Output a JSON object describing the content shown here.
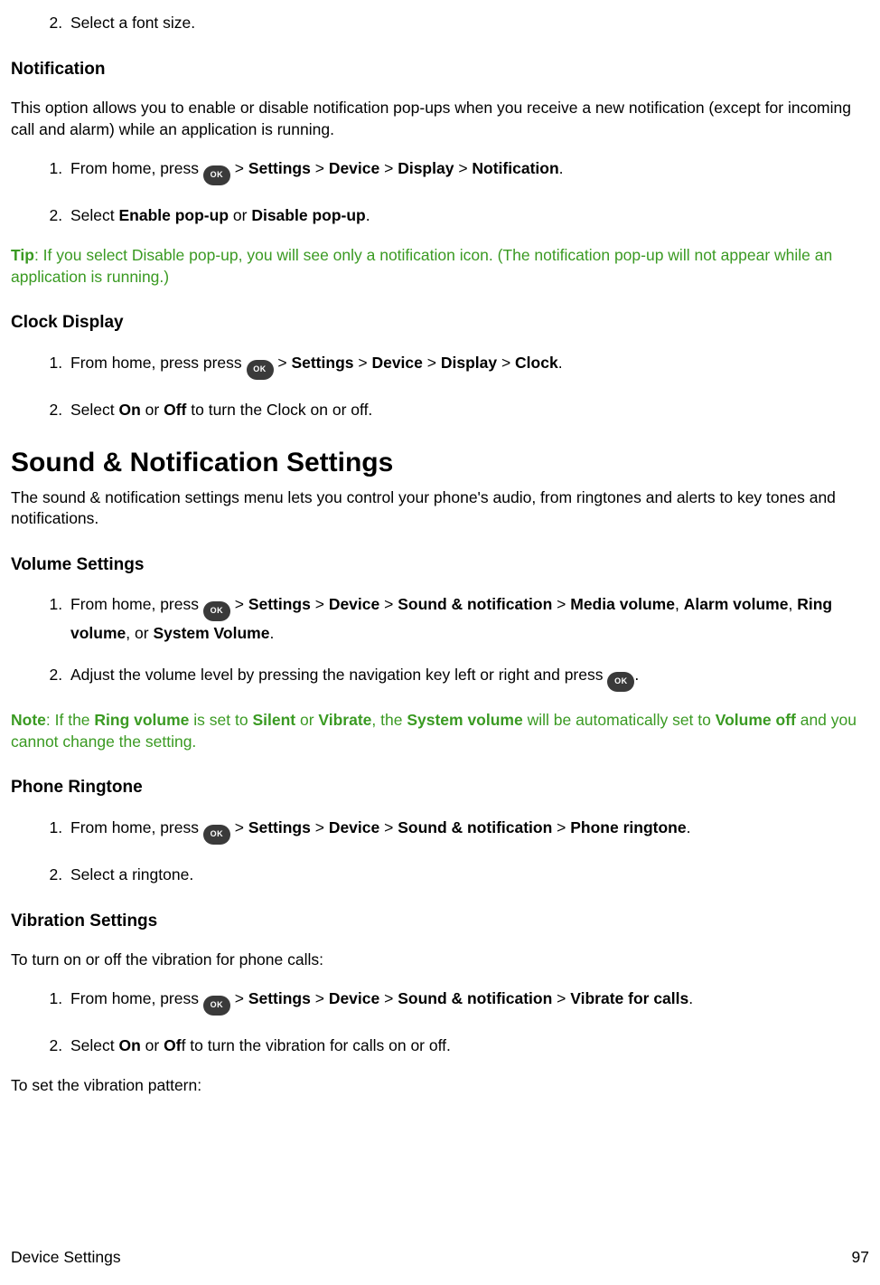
{
  "ok_label": "OK",
  "top_item": {
    "num": "2.",
    "text": "Select a font size."
  },
  "notification": {
    "heading": "Notification",
    "intro": "This option allows you to enable or disable notification pop-ups when you receive a new notification (except for incoming call and alarm) while an application is running.",
    "step1": {
      "pre": "From home, press ",
      "gt": " > ",
      "settings": "Settings",
      "device": "Device",
      "display": "Display",
      "notif": "Notification",
      "end": "."
    },
    "step2": {
      "pre": "Select ",
      "a": "Enable pop-up",
      "mid": " or ",
      "b": "Disable pop-up",
      "end": "."
    },
    "tip_label": "Tip",
    "tip_text": ": If you select Disable pop-up, you will see only a notification icon. (The notification pop-up will not appear while an application is running.)"
  },
  "clock": {
    "heading": "Clock Display",
    "step1": {
      "pre": "From home, press press ",
      "gt": " > ",
      "settings": "Settings",
      "device": "Device",
      "display": "Display",
      "clock": "Clock",
      "end": "."
    },
    "step2": {
      "pre": "Select ",
      "on": "On",
      "mid": " or ",
      "off": "Off",
      "rest": " to turn the Clock on or off."
    }
  },
  "sound": {
    "heading": "Sound & Notification Settings",
    "intro": "The sound & notification settings menu lets you control your phone's audio, from ringtones and alerts to key tones and notifications."
  },
  "volume": {
    "heading": "Volume Settings",
    "step1": {
      "pre": "From home, press ",
      "gt": " > ",
      "settings": "Settings",
      "device": "Device",
      "sn": "Sound & notification",
      "media": "Media volume",
      "comma": ", ",
      "alarm": "Alarm volume",
      "ring": "Ring volume",
      "or": ", or ",
      "system": "System Volume",
      "end": "."
    },
    "step2": {
      "pre": "Adjust the volume level by pressing the navigation key left or right and press ",
      "end": "."
    },
    "note_label": "Note",
    "note": {
      "a": ": If the ",
      "ring": "Ring volume",
      "b": " is set to ",
      "silent": "Silent",
      "c": " or ",
      "vibrate": "Vibrate",
      "d": ", the ",
      "system": "System volume",
      "e": " will be automatically set to ",
      "voff": "Volume off",
      "f": " and you cannot change the setting."
    }
  },
  "ringtone": {
    "heading": "Phone Ringtone",
    "step1": {
      "pre": "From home, press ",
      "gt": " > ",
      "settings": "Settings",
      "device": "Device",
      "sn": "Sound & notification",
      "pr": "Phone ringtone",
      "end": "."
    },
    "step2": "Select a ringtone."
  },
  "vibration": {
    "heading": "Vibration Settings",
    "intro": "To turn on or off the vibration for phone calls:",
    "step1": {
      "pre": "From home, press ",
      "gt": " > ",
      "settings": "Settings",
      "device": "Device",
      "sn": "Sound & notification",
      "vfc": "Vibrate for calls",
      "end": "."
    },
    "step2": {
      "pre": "Select ",
      "on": "On",
      "mid": " or ",
      "of": "Of",
      "f": "f to turn the vibration for calls on or off."
    },
    "outro": "To set the vibration pattern:"
  },
  "footer": {
    "left": "Device Settings",
    "right": "97"
  }
}
